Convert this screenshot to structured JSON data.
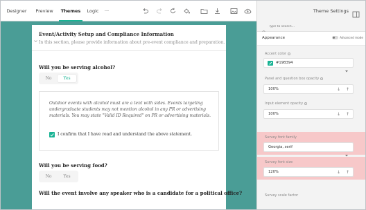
{
  "toolbar": {
    "tabs": [
      {
        "label": "Designer"
      },
      {
        "label": "Preview"
      },
      {
        "label": "Themes"
      },
      {
        "label": "Logic"
      },
      {
        "label": "···"
      }
    ],
    "theme_settings_label": "Theme Settings"
  },
  "survey": {
    "section": {
      "title": "Event/Activity Setup and Compliance Information",
      "description": "In this section, please provide information about pre-event compliance and preparation."
    },
    "q1": {
      "title": "Will you be serving alcohol?",
      "options": [
        "No",
        "Yes"
      ],
      "selected": "Yes"
    },
    "notice": {
      "lines": [
        "Outdoor events with alcohol must are a tent with sides. Events targeting",
        "undergraduate students may not mention alcohol in any PR or advertising",
        "materials. You may state \"Valid ID Required\" on PR or advertising materials."
      ],
      "confirm_label": "I confirm that I have read and understand the above statement."
    },
    "q2": {
      "title": "Will you be serving food?",
      "options": [
        "No",
        "Yes"
      ]
    },
    "q3": {
      "title": "Will the event involve any speaker who is a candidate for a political office?"
    }
  },
  "panel": {
    "search_placeholder": "Type to search...",
    "appearance_label": "Appearance",
    "advanced_mode_label": "Advanced mode",
    "accent_color": {
      "label": "Accent color",
      "value": "#19B394"
    },
    "panel_opacity": {
      "label": "Panel and question box opacity",
      "value": "100%"
    },
    "input_opacity": {
      "label": "Input element opacity",
      "value": "100%"
    },
    "font_family": {
      "label": "Survey font family",
      "value": "Georgia, serif"
    },
    "font_size": {
      "label": "Survey font size",
      "value": "120%"
    },
    "scale_factor": {
      "label": "Survey scale factor"
    }
  },
  "colors": {
    "accent": "#19b394",
    "canvas_bg": "#4a9d96",
    "highlight": "#f7c8c9"
  }
}
